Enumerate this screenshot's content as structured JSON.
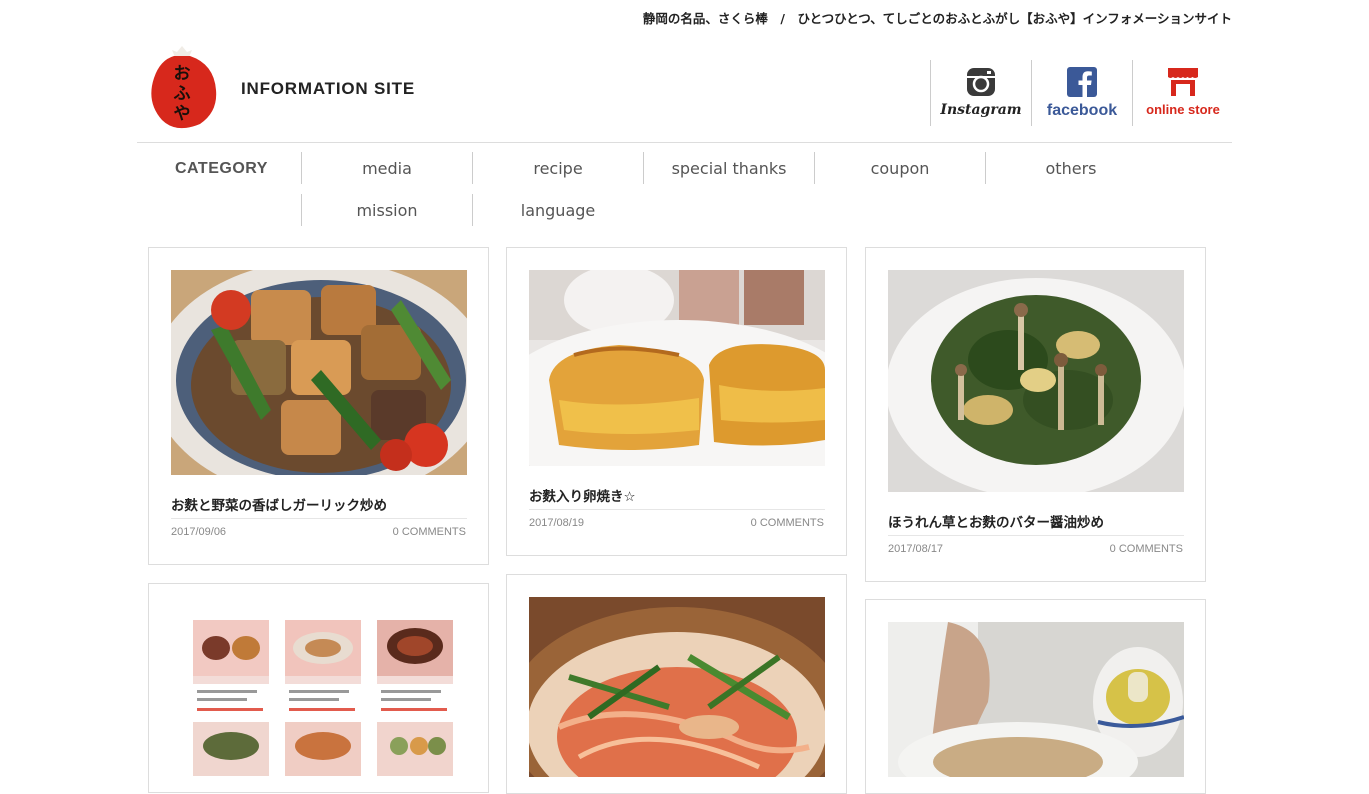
{
  "header": {
    "tagline": "静岡の名品、さくら棒　/　ひとつひとつ、てしごとのおふとふがし【おふや】インフォメーションサイト",
    "logo_text": "おふや",
    "site_title": "INFORMATION SITE"
  },
  "social": {
    "instagram_label": "Instagram",
    "facebook_label": "facebook",
    "store_label": "online store"
  },
  "colors": {
    "brand_red": "#d7281c",
    "facebook_blue": "#3b5998",
    "store_red": "#d7281c",
    "text_dark": "#222222",
    "text_muted": "#888888"
  },
  "nav": {
    "category_label": "CATEGORY",
    "items": [
      "media",
      "recipe",
      "special thanks",
      "coupon",
      "others",
      "mission",
      "language"
    ]
  },
  "posts": [
    {
      "title": "お麩と野菜の香ばしガーリック炒め",
      "date": "2017/09/06",
      "comments": "0 COMMENTS"
    },
    {
      "title": "お麩入り卵焼き☆",
      "date": "2017/08/19",
      "comments": "0 COMMENTS"
    },
    {
      "title": "ほうれん草とお麩のバター醤油炒め",
      "date": "2017/08/17",
      "comments": "0 COMMENTS"
    },
    {
      "title": "",
      "date": "",
      "comments": ""
    },
    {
      "title": "",
      "date": "",
      "comments": ""
    },
    {
      "title": "",
      "date": "",
      "comments": ""
    }
  ]
}
